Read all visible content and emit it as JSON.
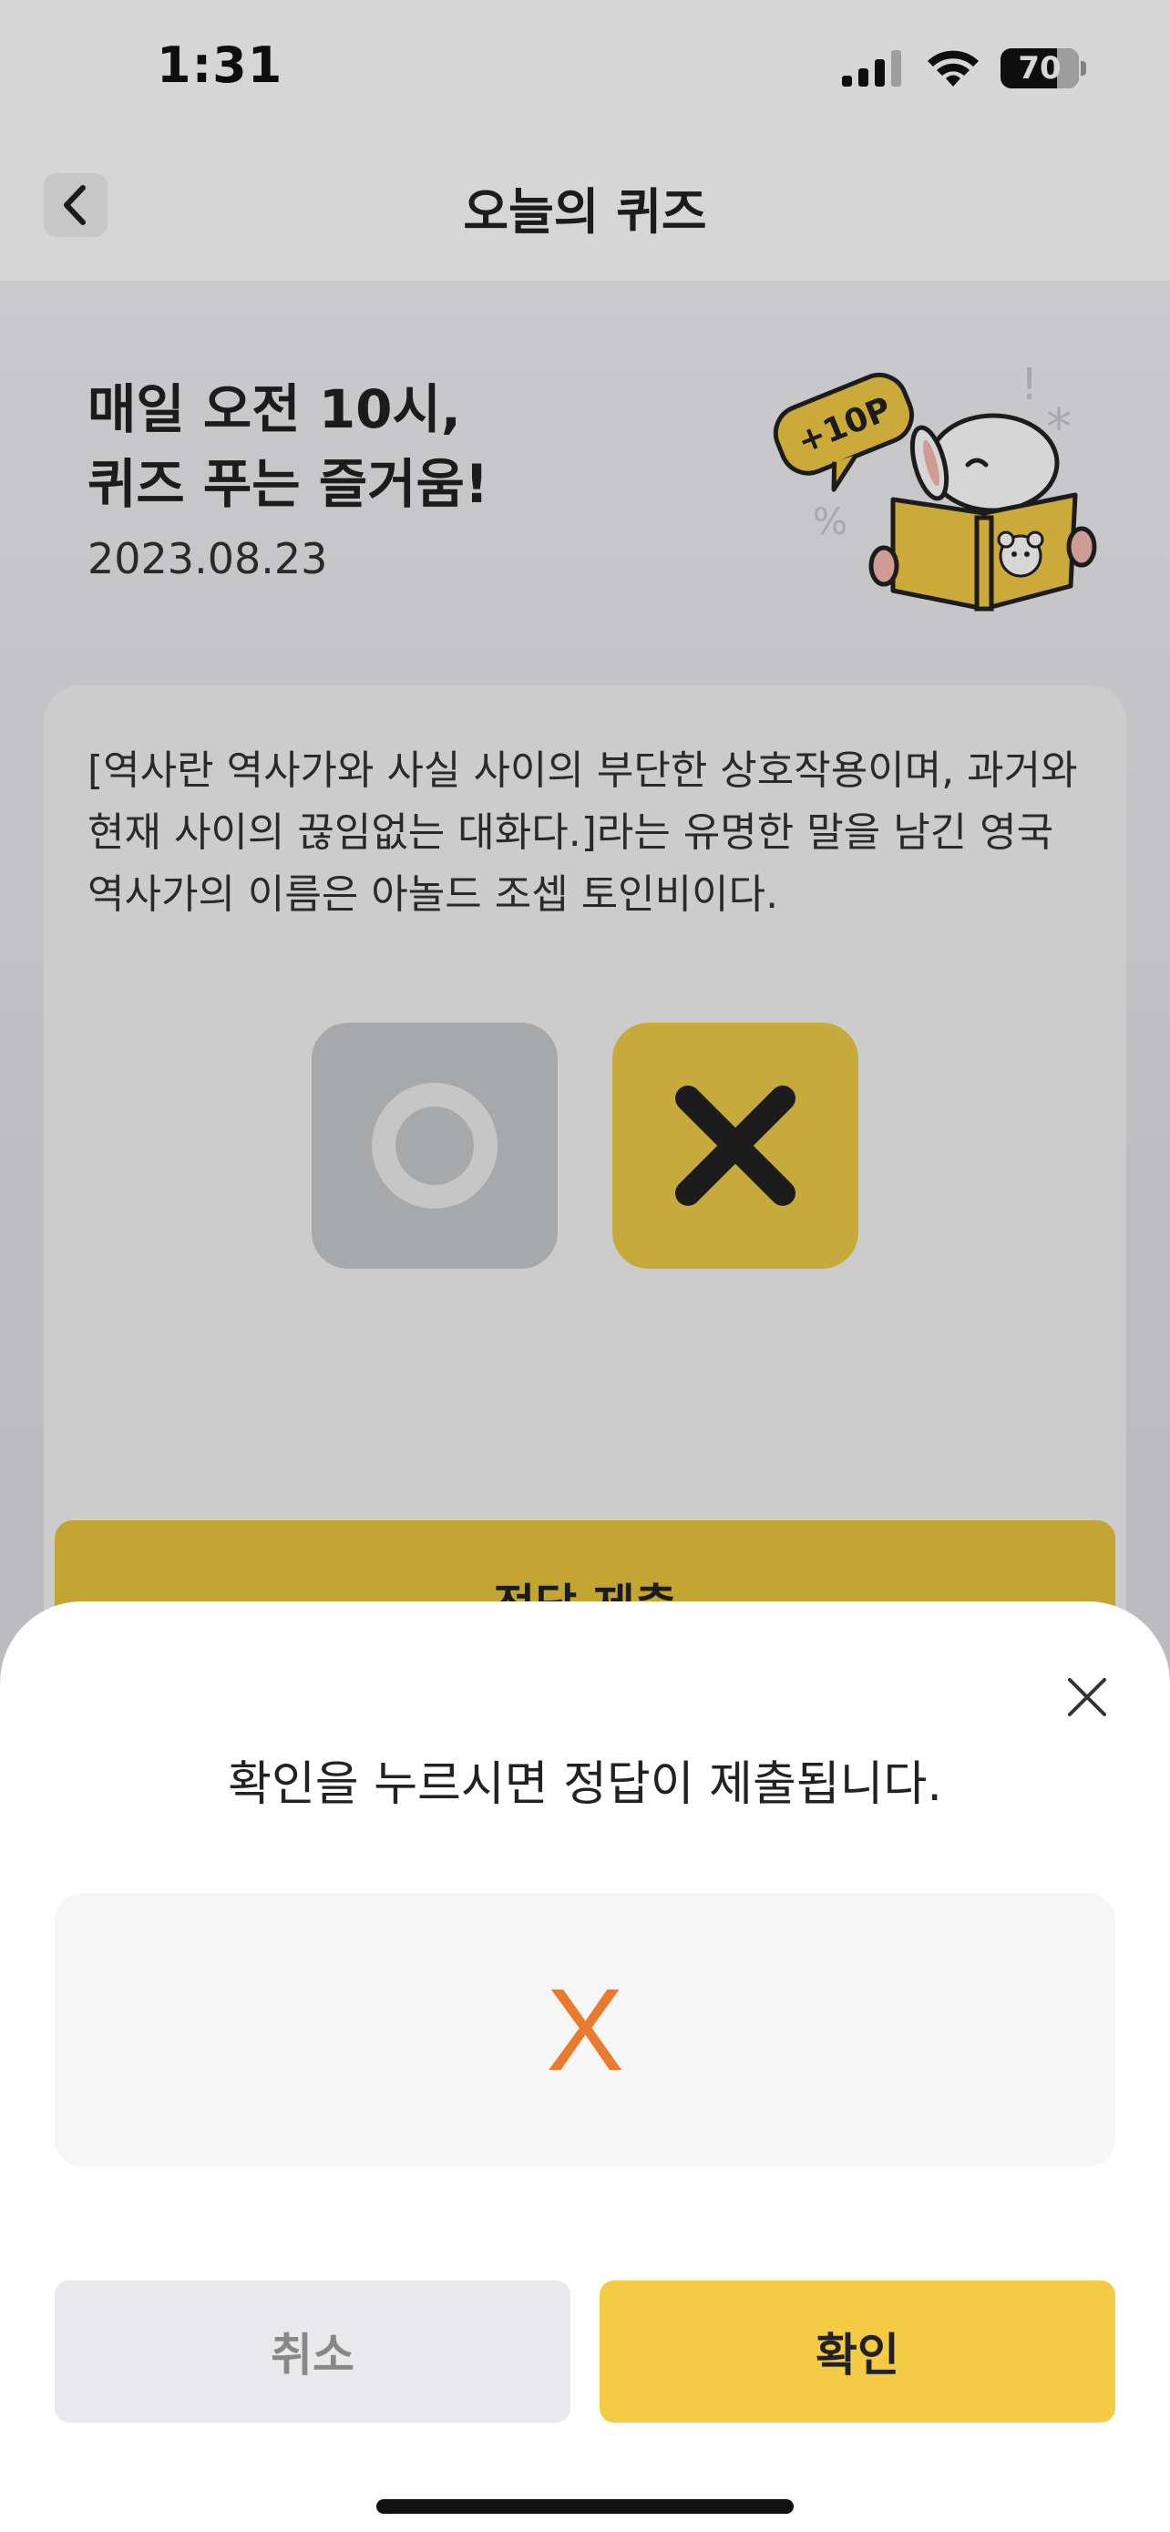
{
  "status": {
    "time": "1:31",
    "battery": "70"
  },
  "nav": {
    "title": "오늘의 퀴즈"
  },
  "hero": {
    "title": "매일 오전 10시,\n퀴즈 푸는 즐거움!",
    "date": "2023.08.23",
    "badge": "+10P"
  },
  "quiz": {
    "question": "[역사란 역사가와 사실 사이의 부단한 상호작용이며, 과거와 현재 사이의 끊임없는 대화다.]라는 유명한 말을 남긴 영국 역사가의 이름은 아놀드 조셉 토인비이다."
  },
  "submit": {
    "label": "정답 제출"
  },
  "sheet": {
    "message": "확인을 누르시면 정답이 제출됩니다.",
    "answer": "X",
    "cancel_label": "취소",
    "confirm_label": "확인"
  },
  "colors": {
    "accent_yellow": "#f4cb45",
    "answer_orange": "#ea7a2e",
    "o_button_gray": "#c8c9cb"
  },
  "icons": {
    "back": "chevron-left-icon",
    "close": "close-icon",
    "choice_o": "circle-o-icon",
    "choice_x": "x-mark-icon"
  }
}
